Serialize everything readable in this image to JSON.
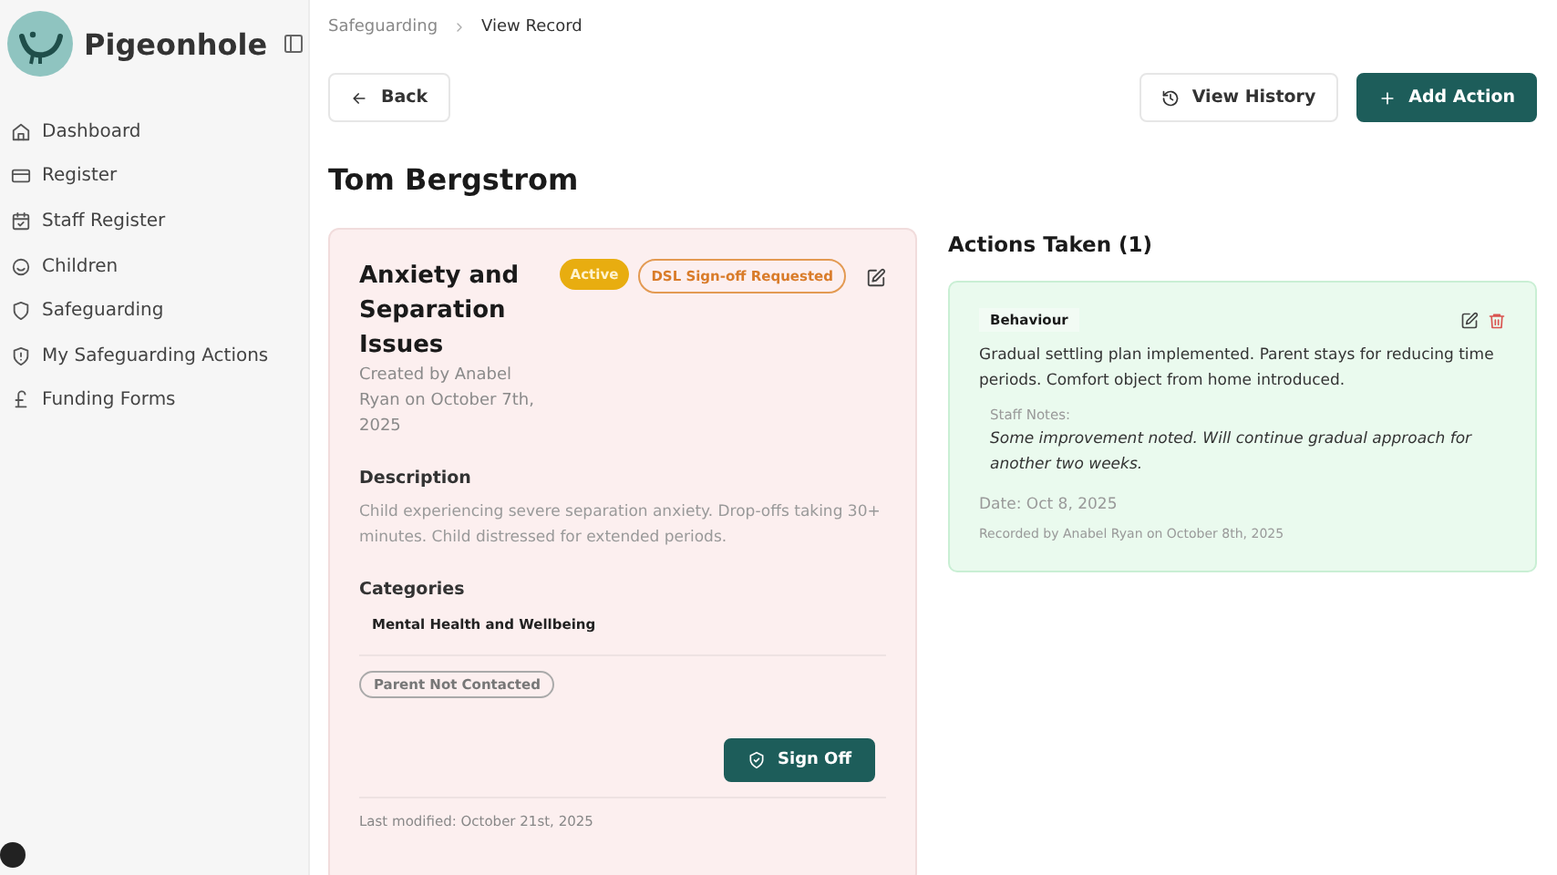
{
  "sidebar": {
    "brand": "Pigeonhole",
    "items": [
      {
        "label": "Dashboard",
        "selected": false
      },
      {
        "label": "Register",
        "selected": false
      },
      {
        "label": "Staff Register",
        "selected": false
      },
      {
        "label": "Children",
        "selected": false
      },
      {
        "label": "Safeguarding",
        "selected": false
      },
      {
        "label": "My Safeguarding Actions",
        "selected": false
      },
      {
        "label": "Funding Forms",
        "selected": false
      }
    ]
  },
  "breadcrumb": [
    "Safeguarding",
    "View Record"
  ],
  "toolbar": {
    "back": "Back",
    "history": "View History",
    "add": "Add Action"
  },
  "child_name": "Tom Bergstrom",
  "record": {
    "title": "Anxiety and Separation Issues",
    "badges": [
      {
        "label": "Active",
        "kind": "solid"
      },
      {
        "label": "DSL Sign-off Requested",
        "kind": "outline"
      }
    ],
    "created": "Created by Anabel Ryan on October 7th, 2025",
    "description_label": "Description",
    "description": "Child experiencing severe separation anxiety. Drop-offs taking 30+ minutes. Child distressed for extended periods.",
    "categories_label": "Categories",
    "categories": [
      "Mental Health and Wellbeing"
    ],
    "flags": [
      "Parent Not Contacted"
    ],
    "sign_off": "Sign Off",
    "modified": "Last modified: October 21st, 2025"
  },
  "actions": {
    "heading": "Actions Taken (1)",
    "items": [
      {
        "type": "Behaviour",
        "text": "Gradual settling plan implemented. Parent stays for reducing time periods. Comfort object from home introduced.",
        "notes_label": "Staff Notes:",
        "notes": "Some improvement noted. Will continue gradual approach for another two weeks.",
        "date": "Date: Oct 8, 2025",
        "recorded": "Recorded by Anabel Ryan on October 8th, 2025"
      }
    ]
  }
}
